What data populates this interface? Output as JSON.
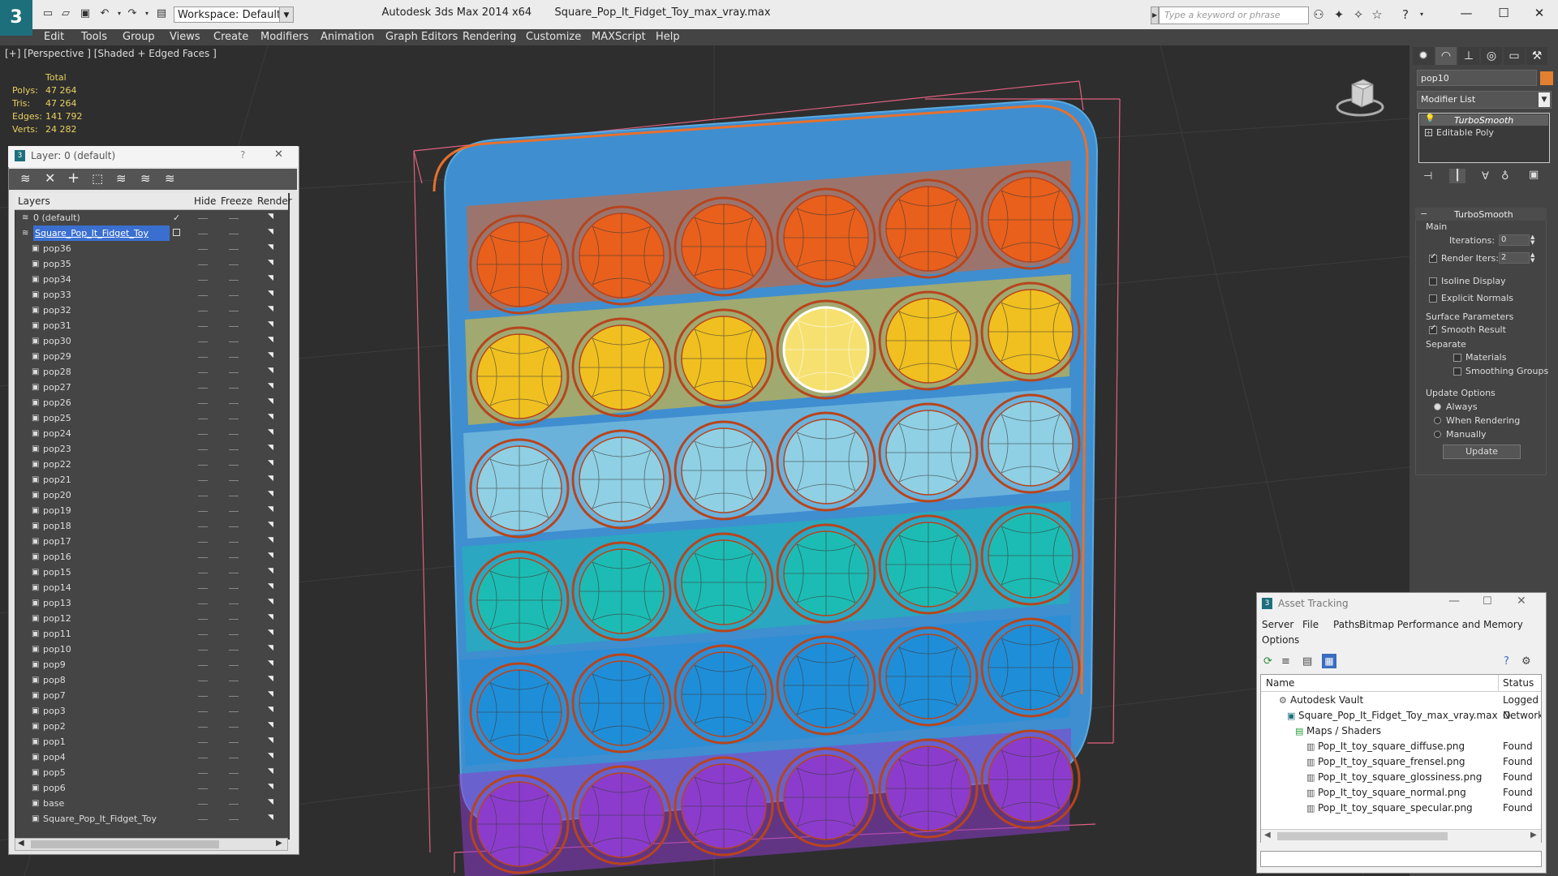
{
  "app": {
    "title": "Autodesk 3ds Max  2014 x64",
    "file": "Square_Pop_It_Fidget_Toy_max_vray.max",
    "workspace": "Workspace: Default",
    "search_placeholder": "Type a keyword or phrase"
  },
  "menu": [
    "Edit",
    "Tools",
    "Group",
    "Views",
    "Create",
    "Modifiers",
    "Animation",
    "Graph Editors",
    "Rendering",
    "Customize",
    "MAXScript",
    "Help"
  ],
  "viewport": {
    "label": "[+] [Perspective ] [Shaded + Edged Faces ]",
    "stats": {
      "header": "Total",
      "rows": [
        {
          "label": "Polys:",
          "value": "47 264"
        },
        {
          "label": "Tris:",
          "value": "47 264"
        },
        {
          "label": "Edges:",
          "value": "141 792"
        },
        {
          "label": "Verts:",
          "value": "24 282"
        }
      ]
    },
    "colors": {
      "rows": [
        "#e8601c",
        "#f0c020",
        "#8fd0e4",
        "#1cbcb4",
        "#1f8ed8",
        "#8c3ccc"
      ],
      "wire": "#b8441c",
      "tray": "#3c9cd8"
    }
  },
  "layers": {
    "title": "Layer: 0 (default)",
    "help": "?",
    "close": "✕",
    "columns": [
      "Layers",
      "Hide",
      "Freeze",
      "Render"
    ],
    "default_layer": "0 (default)",
    "active_layer": "Square_Pop_It_Fidget_Toy",
    "objects": [
      "pop36",
      "pop35",
      "pop34",
      "pop33",
      "pop32",
      "pop31",
      "pop30",
      "pop29",
      "pop28",
      "pop27",
      "pop26",
      "pop25",
      "pop24",
      "pop23",
      "pop22",
      "pop21",
      "pop20",
      "pop19",
      "pop18",
      "pop17",
      "pop16",
      "pop15",
      "pop14",
      "pop13",
      "pop12",
      "pop11",
      "pop10",
      "pop9",
      "pop8",
      "pop7",
      "pop3",
      "pop2",
      "pop1",
      "pop4",
      "pop5",
      "pop6",
      "base",
      "Square_Pop_It_Fidget_Toy"
    ]
  },
  "command_panel": {
    "object_name": "pop10",
    "object_color": "#e08030",
    "modifier_list": "Modifier List",
    "stack": [
      "TurboSmooth",
      "Editable Poly"
    ],
    "rollout_title": "TurboSmooth",
    "main_label": "Main",
    "iterations_label": "Iterations:",
    "iterations_value": "0",
    "render_iters_label": "Render Iters:",
    "render_iters_value": "2",
    "isoline": "Isoline Display",
    "explicit_normals": "Explicit Normals",
    "surface_params": "Surface Parameters",
    "smooth_result": "Smooth Result",
    "separate": "Separate",
    "materials": "Materials",
    "smoothing_groups": "Smoothing Groups",
    "update_options": "Update Options",
    "always": "Always",
    "when_rendering": "When Rendering",
    "manually": "Manually",
    "update_button": "Update"
  },
  "asset_tracking": {
    "title": "Asset Tracking",
    "menu": [
      "Server",
      "File",
      "Paths",
      "Bitmap Performance and Memory"
    ],
    "menu2": "Options",
    "columns": [
      "Name",
      "Status"
    ],
    "rows": [
      {
        "name": "Autodesk Vault",
        "status": "Logged O"
      },
      {
        "name": "Square_Pop_It_Fidget_Toy_max_vray.max",
        "status": "Network"
      },
      {
        "name": "Maps / Shaders",
        "status": ""
      },
      {
        "name": "Pop_It_toy_square_diffuse.png",
        "status": "Found"
      },
      {
        "name": "Pop_It_toy_square_frensel.png",
        "status": "Found"
      },
      {
        "name": "Pop_It_toy_square_glossiness.png",
        "status": "Found"
      },
      {
        "name": "Pop_It_toy_square_normal.png",
        "status": "Found"
      },
      {
        "name": "Pop_It_toy_square_specular.png",
        "status": "Found"
      }
    ]
  }
}
